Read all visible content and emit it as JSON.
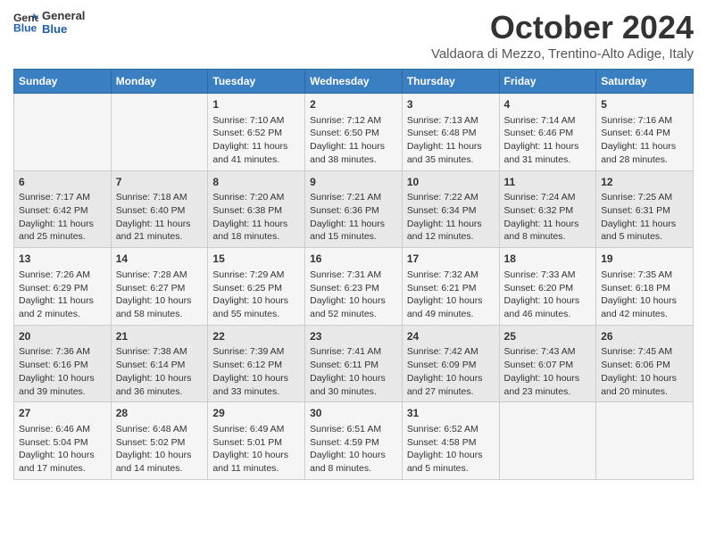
{
  "header": {
    "logo_line1": "General",
    "logo_line2": "Blue",
    "month_title": "October 2024",
    "subtitle": "Valdaora di Mezzo, Trentino-Alto Adige, Italy"
  },
  "days_of_week": [
    "Sunday",
    "Monday",
    "Tuesday",
    "Wednesday",
    "Thursday",
    "Friday",
    "Saturday"
  ],
  "weeks": [
    [
      {
        "day": "",
        "info": ""
      },
      {
        "day": "",
        "info": ""
      },
      {
        "day": "1",
        "info": "Sunrise: 7:10 AM\nSunset: 6:52 PM\nDaylight: 11 hours and 41 minutes."
      },
      {
        "day": "2",
        "info": "Sunrise: 7:12 AM\nSunset: 6:50 PM\nDaylight: 11 hours and 38 minutes."
      },
      {
        "day": "3",
        "info": "Sunrise: 7:13 AM\nSunset: 6:48 PM\nDaylight: 11 hours and 35 minutes."
      },
      {
        "day": "4",
        "info": "Sunrise: 7:14 AM\nSunset: 6:46 PM\nDaylight: 11 hours and 31 minutes."
      },
      {
        "day": "5",
        "info": "Sunrise: 7:16 AM\nSunset: 6:44 PM\nDaylight: 11 hours and 28 minutes."
      }
    ],
    [
      {
        "day": "6",
        "info": "Sunrise: 7:17 AM\nSunset: 6:42 PM\nDaylight: 11 hours and 25 minutes."
      },
      {
        "day": "7",
        "info": "Sunrise: 7:18 AM\nSunset: 6:40 PM\nDaylight: 11 hours and 21 minutes."
      },
      {
        "day": "8",
        "info": "Sunrise: 7:20 AM\nSunset: 6:38 PM\nDaylight: 11 hours and 18 minutes."
      },
      {
        "day": "9",
        "info": "Sunrise: 7:21 AM\nSunset: 6:36 PM\nDaylight: 11 hours and 15 minutes."
      },
      {
        "day": "10",
        "info": "Sunrise: 7:22 AM\nSunset: 6:34 PM\nDaylight: 11 hours and 12 minutes."
      },
      {
        "day": "11",
        "info": "Sunrise: 7:24 AM\nSunset: 6:32 PM\nDaylight: 11 hours and 8 minutes."
      },
      {
        "day": "12",
        "info": "Sunrise: 7:25 AM\nSunset: 6:31 PM\nDaylight: 11 hours and 5 minutes."
      }
    ],
    [
      {
        "day": "13",
        "info": "Sunrise: 7:26 AM\nSunset: 6:29 PM\nDaylight: 11 hours and 2 minutes."
      },
      {
        "day": "14",
        "info": "Sunrise: 7:28 AM\nSunset: 6:27 PM\nDaylight: 10 hours and 58 minutes."
      },
      {
        "day": "15",
        "info": "Sunrise: 7:29 AM\nSunset: 6:25 PM\nDaylight: 10 hours and 55 minutes."
      },
      {
        "day": "16",
        "info": "Sunrise: 7:31 AM\nSunset: 6:23 PM\nDaylight: 10 hours and 52 minutes."
      },
      {
        "day": "17",
        "info": "Sunrise: 7:32 AM\nSunset: 6:21 PM\nDaylight: 10 hours and 49 minutes."
      },
      {
        "day": "18",
        "info": "Sunrise: 7:33 AM\nSunset: 6:20 PM\nDaylight: 10 hours and 46 minutes."
      },
      {
        "day": "19",
        "info": "Sunrise: 7:35 AM\nSunset: 6:18 PM\nDaylight: 10 hours and 42 minutes."
      }
    ],
    [
      {
        "day": "20",
        "info": "Sunrise: 7:36 AM\nSunset: 6:16 PM\nDaylight: 10 hours and 39 minutes."
      },
      {
        "day": "21",
        "info": "Sunrise: 7:38 AM\nSunset: 6:14 PM\nDaylight: 10 hours and 36 minutes."
      },
      {
        "day": "22",
        "info": "Sunrise: 7:39 AM\nSunset: 6:12 PM\nDaylight: 10 hours and 33 minutes."
      },
      {
        "day": "23",
        "info": "Sunrise: 7:41 AM\nSunset: 6:11 PM\nDaylight: 10 hours and 30 minutes."
      },
      {
        "day": "24",
        "info": "Sunrise: 7:42 AM\nSunset: 6:09 PM\nDaylight: 10 hours and 27 minutes."
      },
      {
        "day": "25",
        "info": "Sunrise: 7:43 AM\nSunset: 6:07 PM\nDaylight: 10 hours and 23 minutes."
      },
      {
        "day": "26",
        "info": "Sunrise: 7:45 AM\nSunset: 6:06 PM\nDaylight: 10 hours and 20 minutes."
      }
    ],
    [
      {
        "day": "27",
        "info": "Sunrise: 6:46 AM\nSunset: 5:04 PM\nDaylight: 10 hours and 17 minutes."
      },
      {
        "day": "28",
        "info": "Sunrise: 6:48 AM\nSunset: 5:02 PM\nDaylight: 10 hours and 14 minutes."
      },
      {
        "day": "29",
        "info": "Sunrise: 6:49 AM\nSunset: 5:01 PM\nDaylight: 10 hours and 11 minutes."
      },
      {
        "day": "30",
        "info": "Sunrise: 6:51 AM\nSunset: 4:59 PM\nDaylight: 10 hours and 8 minutes."
      },
      {
        "day": "31",
        "info": "Sunrise: 6:52 AM\nSunset: 4:58 PM\nDaylight: 10 hours and 5 minutes."
      },
      {
        "day": "",
        "info": ""
      },
      {
        "day": "",
        "info": ""
      }
    ]
  ]
}
